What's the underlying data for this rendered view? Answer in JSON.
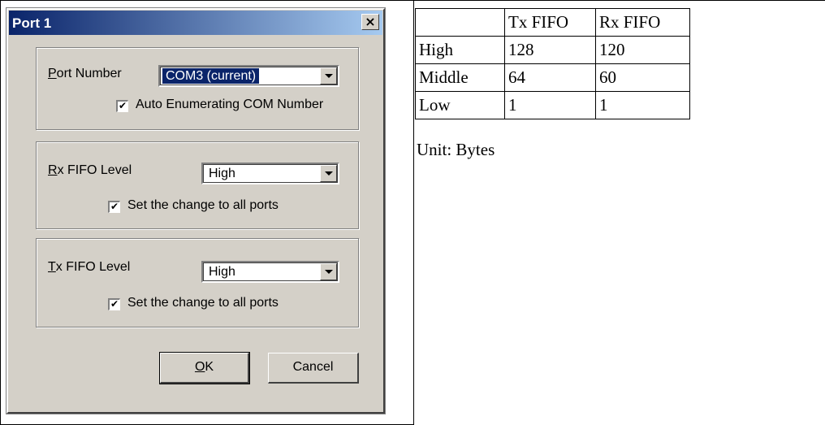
{
  "dialog": {
    "title": "Port 1",
    "close_glyph": "×",
    "port_group": {
      "label": "Port Number",
      "value": "COM3 (current)",
      "checkbox_checked": true,
      "checkbox_label": "Auto Enumerating COM Number"
    },
    "rx_group": {
      "label": "Rx FIFO Level",
      "value": "High",
      "checkbox_checked": true,
      "checkbox_label": "Set the change to all ports"
    },
    "tx_group": {
      "label": "Tx FIFO Level",
      "value": "High",
      "checkbox_checked": true,
      "checkbox_label": "Set the change to all ports"
    },
    "ok_label": "OK",
    "cancel_label": "Cancel"
  },
  "fifo_table": {
    "headers": [
      "",
      "Tx FIFO",
      "Rx FIFO"
    ],
    "rows": [
      [
        "High",
        "128",
        "120"
      ],
      [
        "Middle",
        "64",
        "60"
      ],
      [
        "Low",
        "1",
        "1"
      ]
    ],
    "note": "Unit: Bytes"
  },
  "colors": {
    "titlebar_start": "#0a246a",
    "titlebar_end": "#a6caf0",
    "dialog_face": "#d4d0c8",
    "selection": "#0a246a"
  }
}
